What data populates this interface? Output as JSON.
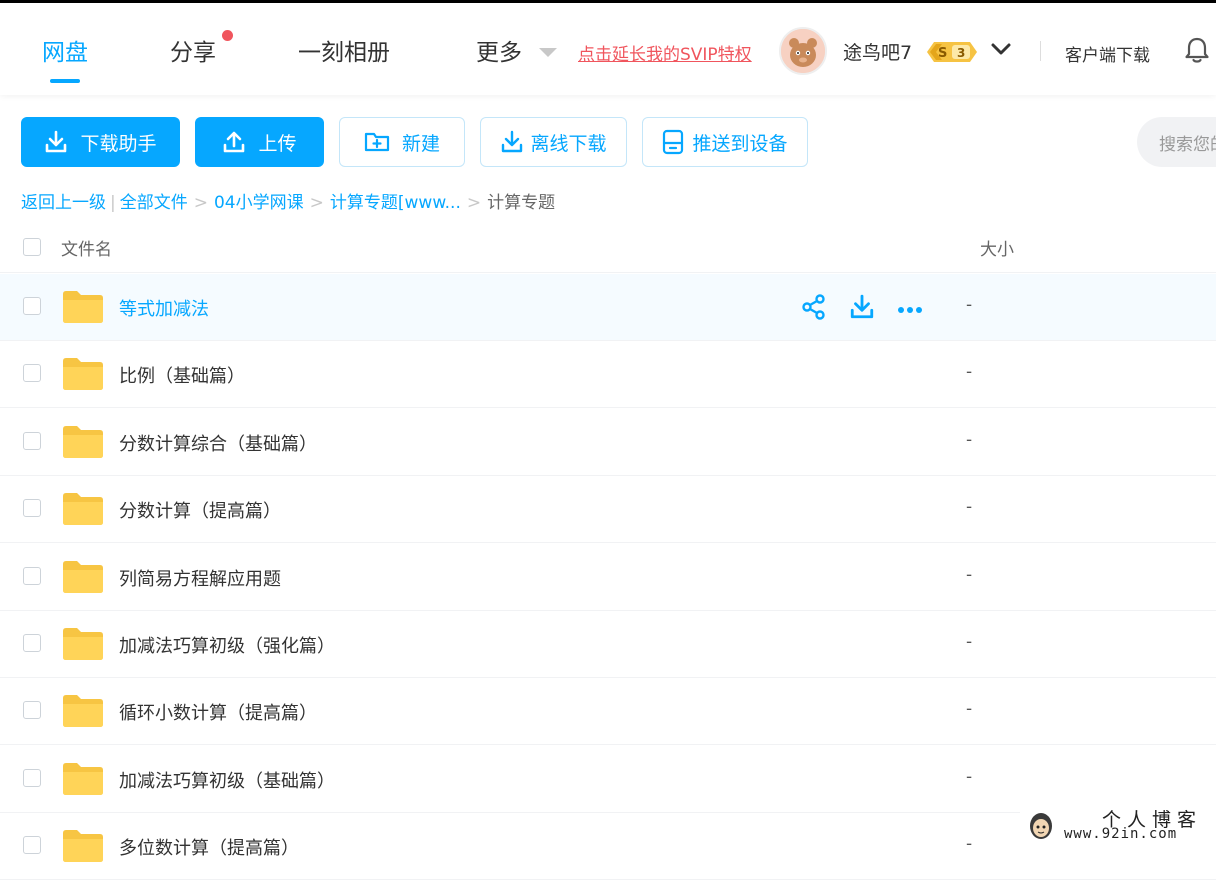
{
  "header": {
    "nav": [
      {
        "label": "网盘",
        "active": true
      },
      {
        "label": "分享",
        "badge_dot": true
      },
      {
        "label": "一刻相册"
      },
      {
        "label": "更多"
      }
    ],
    "promo": "点击延长我的SVIP特权",
    "username": "途鸟吧7",
    "svip_level": "3",
    "client_download": "客户端下载"
  },
  "toolbar": {
    "download_helper": "下载助手",
    "upload": "上传",
    "new": "新建",
    "offline_download": "离线下载",
    "push_device": "推送到设备",
    "search_placeholder": "搜索您的文件"
  },
  "breadcrumb": {
    "back": "返回上一级",
    "items": [
      "全部文件",
      "04小学网课",
      "计算专题[www..."
    ],
    "current": "计算专题"
  },
  "table": {
    "col_name": "文件名",
    "col_size": "大小",
    "rows": [
      {
        "name": "等式加减法",
        "size": "-"
      },
      {
        "name": "比例（基础篇）",
        "size": "-"
      },
      {
        "name": "分数计算综合（基础篇）",
        "size": "-"
      },
      {
        "name": "分数计算（提高篇）",
        "size": "-"
      },
      {
        "name": "列简易方程解应用题",
        "size": "-"
      },
      {
        "name": "加减法巧算初级（强化篇）",
        "size": "-"
      },
      {
        "name": "循环小数计算（提高篇）",
        "size": "-"
      },
      {
        "name": "加减法巧算初级（基础篇）",
        "size": "-"
      },
      {
        "name": "多位数计算（提高篇）",
        "size": "-"
      }
    ]
  },
  "watermark": {
    "title": "个人博客",
    "url": "www.92in.com"
  },
  "colors": {
    "accent": "#06a7ff",
    "promo_red": "#f0555d",
    "folder_yellow": "#ffd458",
    "hover_row": "#f5fbff"
  }
}
